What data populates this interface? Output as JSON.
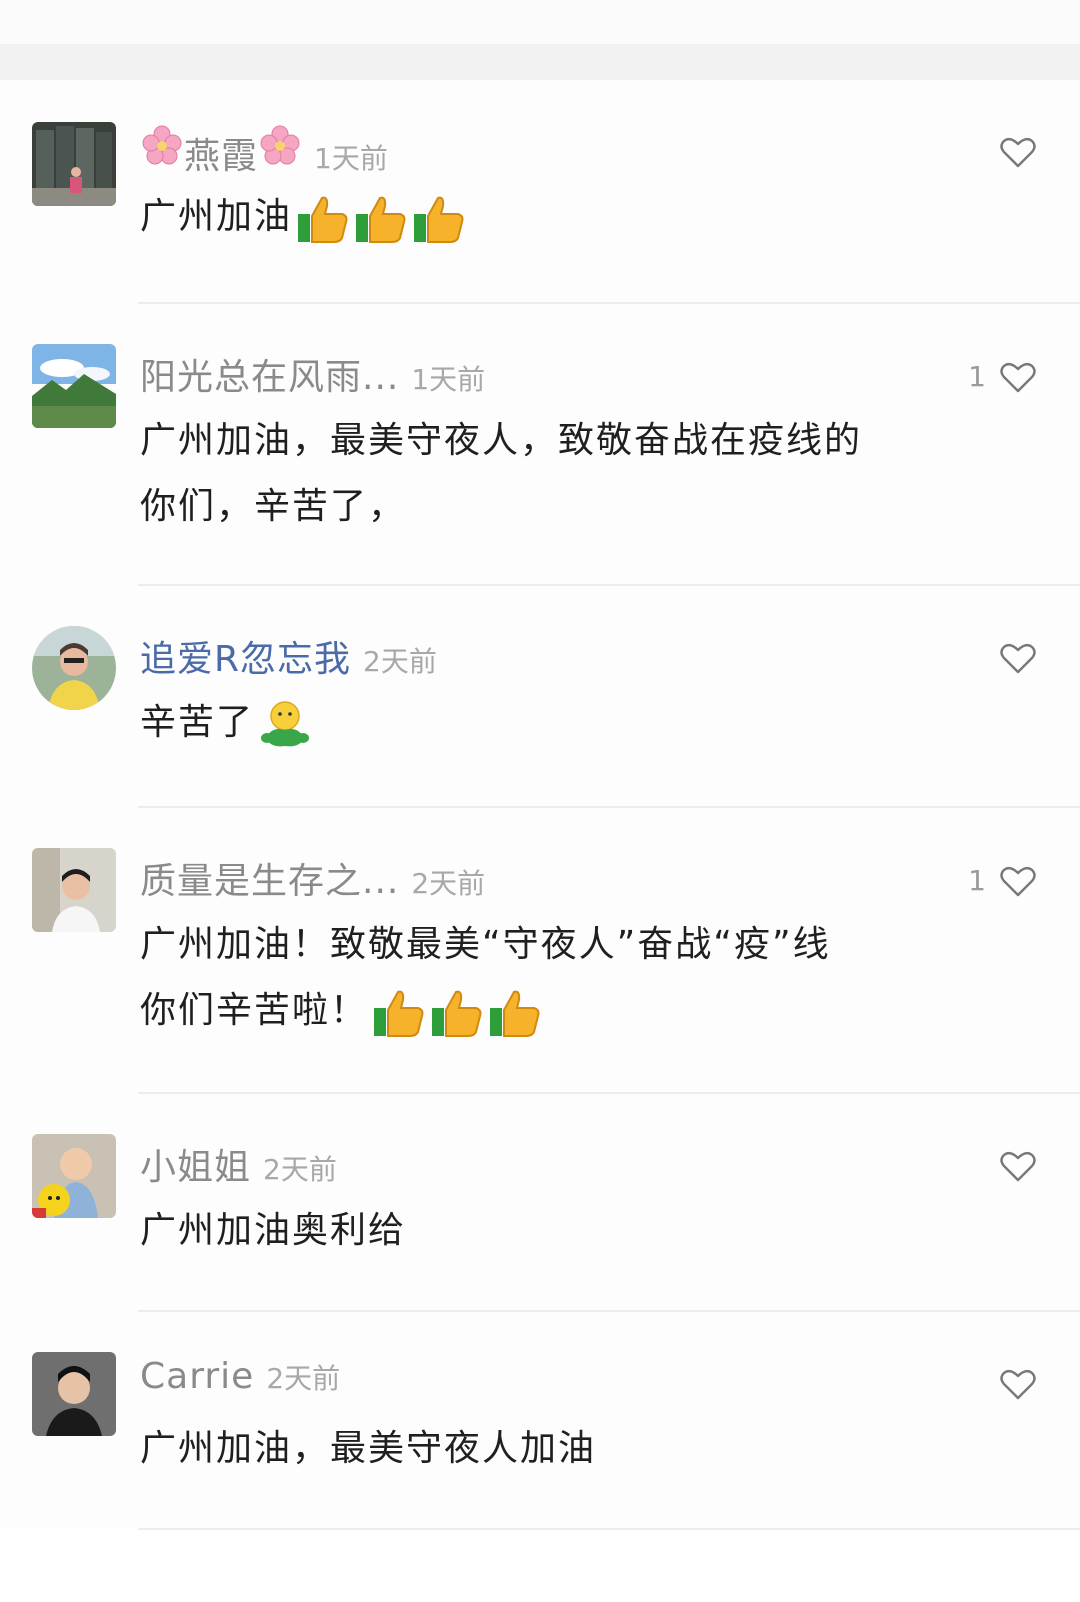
{
  "comments": [
    {
      "name_prefix_icon": "cherry-blossom",
      "name": "燕霞",
      "name_suffix_icon": "cherry-blossom",
      "time": "1天前",
      "text": "广州加油",
      "text_emojis": [
        "thumbs-up",
        "thumbs-up",
        "thumbs-up"
      ],
      "likes": ""
    },
    {
      "name": "阳光总在风雨...",
      "time": "1天前",
      "text_line1": "广州加油，最美守夜人，致敬奋战在疫线的",
      "text_line2": "你们，辛苦了，",
      "likes": "1"
    },
    {
      "name": "追爱R忽忘我",
      "time": "2天前",
      "text": "辛苦了",
      "text_emojis": [
        "hug-emoji"
      ],
      "likes": ""
    },
    {
      "name": "质量是生存之...",
      "time": "2天前",
      "text_line1": "广州加油！致敬最美“守夜人”奋战“疫”线",
      "text_line2": "你们辛苦啦！",
      "text_emojis": [
        "thumbs-up",
        "thumbs-up",
        "thumbs-up"
      ],
      "likes": "1"
    },
    {
      "name": "小姐姐",
      "time": "2天前",
      "text": "广州加油奥利给",
      "likes": ""
    },
    {
      "name": "Carrie",
      "time": "2天前",
      "text": "广州加油，最美守夜人加油",
      "likes": ""
    }
  ],
  "icons": {
    "like": "heart-outline-icon"
  },
  "colors": {
    "name": "#8a8a8a",
    "name_vip": "#4a6aa8",
    "time": "#a8a8a8",
    "text": "#1f1f1f",
    "separator": "#ececec"
  }
}
